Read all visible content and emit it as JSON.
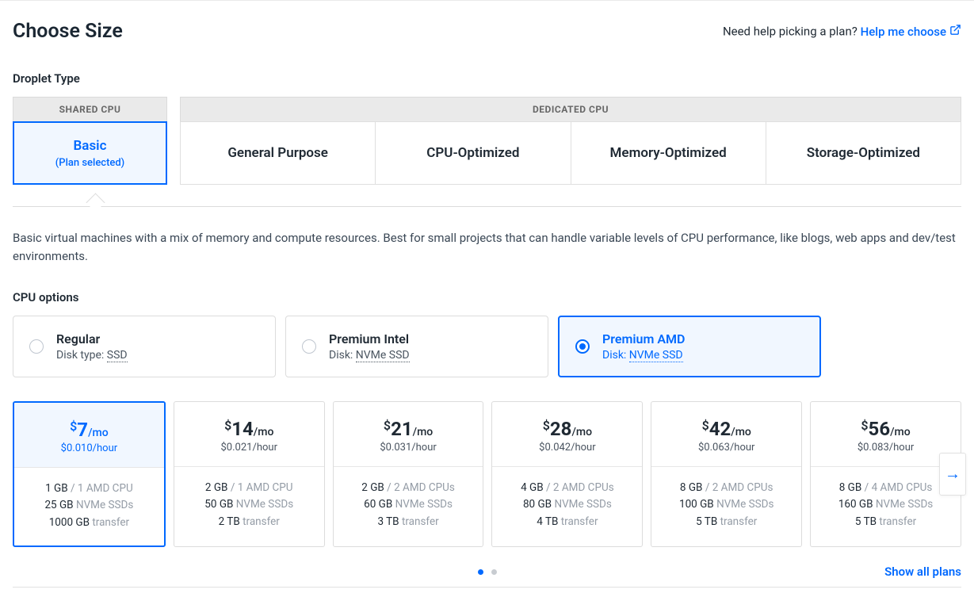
{
  "header": {
    "title": "Choose Size",
    "help_text": "Need help picking a plan? ",
    "help_link": "Help me choose"
  },
  "droplet_type": {
    "label": "Droplet Type",
    "shared_header": "SHARED CPU",
    "dedicated_header": "DEDICATED CPU",
    "shared": {
      "title": "Basic",
      "sub": "(Plan selected)"
    },
    "dedicated": [
      {
        "title": "General Purpose"
      },
      {
        "title": "CPU-Optimized"
      },
      {
        "title": "Memory-Optimized"
      },
      {
        "title": "Storage-Optimized"
      }
    ]
  },
  "description": "Basic virtual machines with a mix of memory and compute resources. Best for small projects that can handle variable levels of CPU performance, like blogs, web apps and dev/test environments.",
  "cpu_options": {
    "label": "CPU options",
    "items": [
      {
        "title": "Regular",
        "sub_label": "Disk type: ",
        "sub_value": "SSD"
      },
      {
        "title": "Premium Intel",
        "sub_label": "Disk: ",
        "sub_value": "NVMe SSD"
      },
      {
        "title": "Premium AMD",
        "sub_label": "Disk: ",
        "sub_value": "NVMe SSD"
      }
    ],
    "selected_index": 2
  },
  "plans": [
    {
      "price": "7",
      "hour": "$0.010/hour",
      "ram": "1 GB",
      "cpu": "1 AMD CPU",
      "disk": "25 GB",
      "disk_type": "NVMe SSDs",
      "xfer": "1000 GB",
      "xfer_label": "transfer"
    },
    {
      "price": "14",
      "hour": "$0.021/hour",
      "ram": "2 GB",
      "cpu": "1 AMD CPU",
      "disk": "50 GB",
      "disk_type": "NVMe SSDs",
      "xfer": "2 TB",
      "xfer_label": "transfer"
    },
    {
      "price": "21",
      "hour": "$0.031/hour",
      "ram": "2 GB",
      "cpu": "2 AMD CPUs",
      "disk": "60 GB",
      "disk_type": "NVMe SSDs",
      "xfer": "3 TB",
      "xfer_label": "transfer"
    },
    {
      "price": "28",
      "hour": "$0.042/hour",
      "ram": "4 GB",
      "cpu": "2 AMD CPUs",
      "disk": "80 GB",
      "disk_type": "NVMe SSDs",
      "xfer": "4 TB",
      "xfer_label": "transfer"
    },
    {
      "price": "42",
      "hour": "$0.063/hour",
      "ram": "8 GB",
      "cpu": "2 AMD CPUs",
      "disk": "100 GB",
      "disk_type": "NVMe SSDs",
      "xfer": "5 TB",
      "xfer_label": "transfer"
    },
    {
      "price": "56",
      "hour": "$0.083/hour",
      "ram": "8 GB",
      "cpu": "4 AMD CPUs",
      "disk": "160 GB",
      "disk_type": "NVMe SSDs",
      "xfer": "5 TB",
      "xfer_label": "transfer"
    }
  ],
  "plan_selected_index": 0,
  "per_mo": "/mo",
  "footer": {
    "show_all": "Show all plans"
  }
}
